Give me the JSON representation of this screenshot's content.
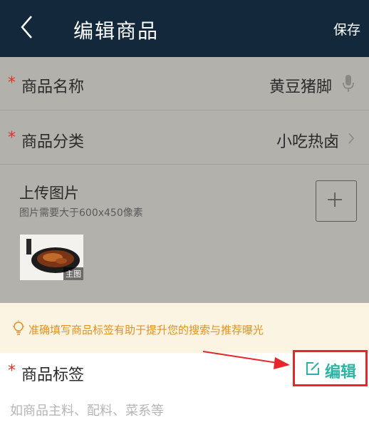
{
  "header": {
    "title": "编辑商品",
    "save_label": "保存"
  },
  "form": {
    "name": {
      "required_mark": "*",
      "label": "商品名称",
      "value": "黄豆猪脚"
    },
    "category": {
      "required_mark": "*",
      "label": "商品分类",
      "value": "小吃热卤"
    },
    "upload": {
      "title": "上传图片",
      "hint": "图片需要大于600x450像素",
      "thumbnail_badge": "主图"
    },
    "tip": {
      "text": "准确填写商品标签有助于提升您的搜索与推荐曝光"
    },
    "tags": {
      "required_mark": "*",
      "label": "商品标签",
      "edit_label": "编辑",
      "placeholder": "如商品主料、配料、菜系等"
    }
  },
  "icons": {
    "back": "chevron-left-icon",
    "voice": "microphone-icon",
    "category_arrow": "chevron-right-icon",
    "add": "plus-icon",
    "tip": "lightbulb-icon",
    "edit": "edit-icon"
  },
  "colors": {
    "header_bg": "#13283a",
    "overlay": "#b3b1ab",
    "required": "#e0302a",
    "accent": "#2bb4a3",
    "tip_text": "#e3901e",
    "tip_bg": "#fcf4e2",
    "highlight": "#e6262a"
  }
}
